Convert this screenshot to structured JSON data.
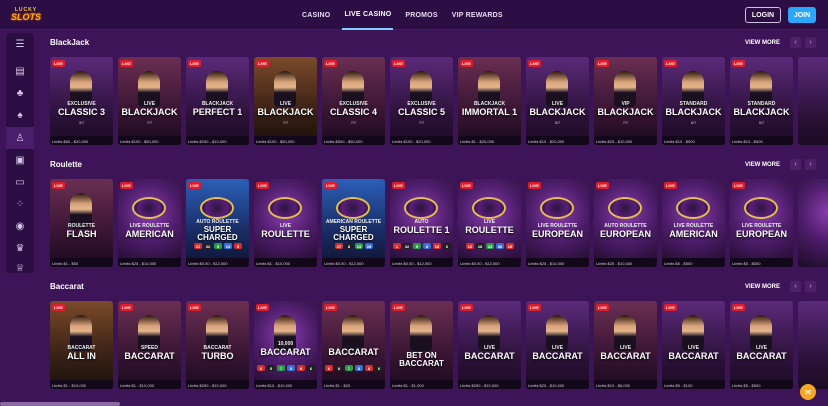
{
  "header": {
    "logo_top": "LUCKY",
    "logo_bottom": "SLOTS",
    "nav": [
      "CASINO",
      "LIVE CASINO",
      "PROMOS",
      "VIP REWARDS"
    ],
    "active_nav": "LIVE CASINO",
    "login": "LOGIN",
    "join": "JOIN"
  },
  "sidebar": {
    "icons": [
      "menu-icon",
      "slots-icon",
      "cherries-icon",
      "spade-icon",
      "live-dealer-icon",
      "cards-icon",
      "monitor-icon",
      "dice-icon",
      "jackpot-icon",
      "trophy-icon",
      "crown-icon"
    ]
  },
  "sections": [
    {
      "title": "BlackJack",
      "view_more": "VIEW MORE",
      "cards": [
        {
          "live": "LIVE",
          "sub": "EXCLUSIVE",
          "name": "CLASSIC 3",
          "players": "3/7",
          "limits": "Limits $50 - $20,000"
        },
        {
          "live": "LIVE",
          "sub": "LIVE",
          "name": "BLACKJACK",
          "players": "7/7",
          "limits": "Limits $100 - $50,000"
        },
        {
          "live": "LIVE",
          "sub": "BLACKJACK",
          "name": "PERFECT 1",
          "players": "",
          "limits": "Limits $250 - $10,000"
        },
        {
          "live": "LIVE",
          "sub": "LIVE",
          "name": "BLACKJACK",
          "players": "7/7",
          "limits": "Limits $100 - $50,000"
        },
        {
          "live": "LIVE",
          "sub": "EXCLUSIVE",
          "name": "CLASSIC 4",
          "players": "7/7",
          "limits": "Limits $500 - $50,000"
        },
        {
          "live": "LIVE",
          "sub": "EXCLUSIVE",
          "name": "CLASSIC 5",
          "players": "7/7",
          "limits": "Limits $100 - $20,000"
        },
        {
          "live": "LIVE",
          "sub": "BLACKJACK",
          "name": "IMMORTAL 1",
          "players": "",
          "limits": "Limits $1 - $20,000"
        },
        {
          "live": "LIVE",
          "sub": "LIVE",
          "name": "BLACKJACK",
          "players": "5/7",
          "limits": "Limits $10 - $20,000"
        },
        {
          "live": "LIVE",
          "sub": "VIP",
          "name": "BLACKJACK",
          "players": "7/7",
          "limits": "Limits $25 - $10,000"
        },
        {
          "live": "LIVE",
          "sub": "STANDARD",
          "name": "BLACKJACK",
          "players": "6/7",
          "limits": "Limits $10 - $500"
        },
        {
          "live": "LIVE",
          "sub": "STANDARD",
          "name": "BLACKJACK",
          "players": "5/7",
          "limits": "Limits $10 - $500"
        },
        {
          "live": "",
          "sub": "",
          "name": "",
          "players": "",
          "limits": ""
        }
      ]
    },
    {
      "title": "Roulette",
      "view_more": "VIEW MORE",
      "cards": [
        {
          "live": "LIVE",
          "sub": "ROULETTE",
          "name": "FLASH",
          "limits": "Limits $1 - $50"
        },
        {
          "live": "LIVE",
          "sub": "LIVE ROULETTE",
          "name": "AMERICAN",
          "limits": "Limits $25 - $10,000"
        },
        {
          "live": "LIVE",
          "sub": "AUTO ROULETTE",
          "name": "SUPER CHARGED",
          "limits": "Limits $0.50 - $12,500",
          "balls": [
            "21",
            "32",
            "5",
            "14",
            "5"
          ]
        },
        {
          "live": "LIVE",
          "sub": "LIVE",
          "name": "ROULETTE",
          "limits": "Limits $1 - $10,000"
        },
        {
          "live": "LIVE",
          "sub": "AMERICAN ROULETTE",
          "name": "SUPER CHARGED",
          "limits": "Limits $0.50 - $12,500",
          "balls": [
            "27",
            "8",
            "23",
            "28"
          ]
        },
        {
          "live": "LIVE",
          "sub": "AUTO",
          "name": "ROULETTE 1",
          "limits": "Limits $0.50 - $12,500",
          "balls": [
            "1",
            "32",
            "9",
            "8",
            "16",
            "6"
          ]
        },
        {
          "live": "LIVE",
          "sub": "LIVE",
          "name": "ROULETTE",
          "limits": "Limits $0.50 - $12,500",
          "balls": [
            "13",
            "28",
            "23",
            "36",
            "19"
          ]
        },
        {
          "live": "LIVE",
          "sub": "LIVE ROULETTE",
          "name": "EUROPEAN",
          "limits": "Limits $25 - $10,000"
        },
        {
          "live": "LIVE",
          "sub": "AUTO ROULETTE",
          "name": "EUROPEAN",
          "limits": "Limits $25 - $10,000"
        },
        {
          "live": "LIVE",
          "sub": "LIVE ROULETTE",
          "name": "AMERICAN",
          "limits": "Limits $5 - $500"
        },
        {
          "live": "LIVE",
          "sub": "LIVE ROULETTE",
          "name": "EUROPEAN",
          "limits": "Limits $5 - $500"
        },
        {
          "live": "",
          "sub": "",
          "name": "",
          "limits": ""
        }
      ]
    },
    {
      "title": "Baccarat",
      "view_more": "VIEW MORE",
      "cards": [
        {
          "live": "LIVE",
          "sub": "BACCARAT",
          "name": "ALL IN",
          "limits": "Limits $1 - $10,000"
        },
        {
          "live": "LIVE",
          "sub": "SPEED",
          "name": "BACCARAT",
          "limits": "Limits $1 - $10,000"
        },
        {
          "live": "LIVE",
          "sub": "BACCARAT",
          "name": "TURBO",
          "limits": "Limits $250 - $10,000"
        },
        {
          "live": "LIVE",
          "sub": "10,000",
          "name": "BACCARAT",
          "limits": "Limits $10 - $10,000",
          "balls": [
            "6",
            "5",
            "7",
            "5",
            "8",
            "6"
          ]
        },
        {
          "live": "LIVE",
          "sub": "",
          "name": "BACCARAT",
          "limits": "Limits $1 - $20",
          "balls": [
            "6",
            "8",
            "7",
            "8",
            "8",
            "6"
          ]
        },
        {
          "live": "LIVE",
          "sub": "",
          "name": "BET ON BACCARAT",
          "limits": "Limits $1 - $1,000"
        },
        {
          "live": "LIVE",
          "sub": "LIVE",
          "name": "BACCARAT",
          "limits": "Limits $250 - $10,000"
        },
        {
          "live": "LIVE",
          "sub": "LIVE",
          "name": "BACCARAT",
          "limits": "Limits $25 - $10,000"
        },
        {
          "live": "LIVE",
          "sub": "LIVE",
          "name": "BACCARAT",
          "limits": "Limits $10 - $5,000"
        },
        {
          "live": "LIVE",
          "sub": "LIVE",
          "name": "BACCARAT",
          "limits": "Limits $5 - $100"
        },
        {
          "live": "LIVE",
          "sub": "LIVE",
          "name": "BACCARAT",
          "limits": "Limits $5 - $500"
        },
        {
          "live": "",
          "sub": "",
          "name": "",
          "limits": ""
        }
      ]
    }
  ]
}
